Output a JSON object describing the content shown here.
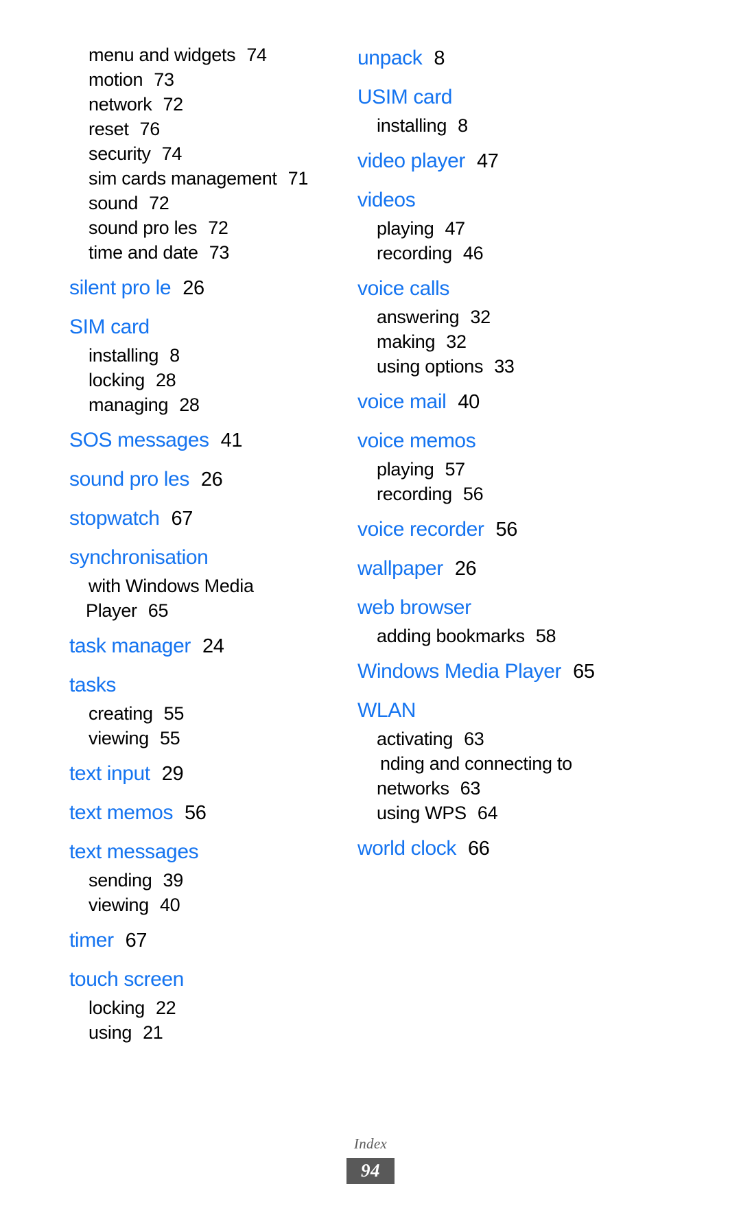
{
  "document": {
    "kind": "index-page",
    "footer_label": "Index",
    "page_number": "94",
    "heading_color": "#1574f0",
    "body_color": "#000000",
    "badge_bg": "#595959",
    "badge_text_color": "#ffffff"
  },
  "columns": [
    {
      "id": "left",
      "entries": [
        {
          "type": "sub",
          "label": "menu and widgets",
          "page": "74"
        },
        {
          "type": "sub",
          "label": "motion",
          "page": "73"
        },
        {
          "type": "sub",
          "label": "network",
          "page": "72"
        },
        {
          "type": "sub",
          "label": "reset",
          "page": "76"
        },
        {
          "type": "sub",
          "label": "security",
          "page": "74"
        },
        {
          "type": "sub",
          "label": "sim cards management",
          "page": "71"
        },
        {
          "type": "sub",
          "label": "sound",
          "page": "72"
        },
        {
          "type": "sub",
          "label": "sound pro  les",
          "page": "72"
        },
        {
          "type": "sub",
          "label": "time and date",
          "page": "73"
        },
        {
          "type": "head",
          "label": "silent pro  le",
          "page": "26"
        },
        {
          "type": "head",
          "label": "SIM card",
          "page": ""
        },
        {
          "type": "sub",
          "label": "installing",
          "page": "8"
        },
        {
          "type": "sub",
          "label": "locking",
          "page": "28"
        },
        {
          "type": "sub",
          "label": "managing",
          "page": "28"
        },
        {
          "type": "head",
          "label": "SOS messages",
          "page": "41"
        },
        {
          "type": "head",
          "label": "sound pro  les",
          "page": "26"
        },
        {
          "type": "head",
          "label": "stopwatch",
          "page": "67"
        },
        {
          "type": "head",
          "label": "synchronisation",
          "page": ""
        },
        {
          "type": "sub",
          "label": "with Windows Media",
          "page": ""
        },
        {
          "type": "sub-cont",
          "label": "Player",
          "page": "65"
        },
        {
          "type": "head",
          "label": "task manager",
          "page": "24"
        },
        {
          "type": "head",
          "label": "tasks",
          "page": ""
        },
        {
          "type": "sub",
          "label": "creating",
          "page": "55"
        },
        {
          "type": "sub",
          "label": "viewing",
          "page": "55"
        },
        {
          "type": "head",
          "label": "text input",
          "page": "29"
        },
        {
          "type": "head",
          "label": "text memos",
          "page": "56"
        },
        {
          "type": "head",
          "label": "text messages",
          "page": ""
        },
        {
          "type": "sub",
          "label": "sending",
          "page": "39"
        },
        {
          "type": "sub",
          "label": "viewing",
          "page": "40"
        },
        {
          "type": "head",
          "label": "timer",
          "page": "67"
        },
        {
          "type": "head",
          "label": "touch screen",
          "page": ""
        },
        {
          "type": "sub",
          "label": "locking",
          "page": "22"
        },
        {
          "type": "sub",
          "label": "using",
          "page": "21"
        }
      ]
    },
    {
      "id": "right",
      "entries": [
        {
          "type": "head",
          "label": "unpack",
          "page": "8"
        },
        {
          "type": "head",
          "label": "USIM card",
          "page": ""
        },
        {
          "type": "sub",
          "label": "installing",
          "page": "8"
        },
        {
          "type": "head",
          "label": "video player",
          "page": "47"
        },
        {
          "type": "head",
          "label": "videos",
          "page": ""
        },
        {
          "type": "sub",
          "label": "playing",
          "page": "47"
        },
        {
          "type": "sub",
          "label": "recording",
          "page": "46"
        },
        {
          "type": "head",
          "label": "voice calls",
          "page": ""
        },
        {
          "type": "sub",
          "label": "answering",
          "page": "32"
        },
        {
          "type": "sub",
          "label": "making",
          "page": "32"
        },
        {
          "type": "sub",
          "label": "using options",
          "page": "33"
        },
        {
          "type": "head",
          "label": "voice mail",
          "page": "40"
        },
        {
          "type": "head",
          "label": "voice memos",
          "page": ""
        },
        {
          "type": "sub",
          "label": "playing",
          "page": "57"
        },
        {
          "type": "sub",
          "label": "recording",
          "page": "56"
        },
        {
          "type": "head",
          "label": "voice recorder",
          "page": "56"
        },
        {
          "type": "head",
          "label": "wallpaper",
          "page": "26"
        },
        {
          "type": "head",
          "label": "web browser",
          "page": ""
        },
        {
          "type": "sub",
          "label": "adding bookmarks",
          "page": "58"
        },
        {
          "type": "head",
          "label": "Windows Media Player",
          "page": "65"
        },
        {
          "type": "head",
          "label": "WLAN",
          "page": ""
        },
        {
          "type": "sub",
          "label": "activating",
          "page": "63"
        },
        {
          "type": "sub-hang",
          "label": " nding and connecting to",
          "page": ""
        },
        {
          "type": "sub",
          "label": "networks",
          "page": "63"
        },
        {
          "type": "sub",
          "label": "using WPS",
          "page": "64"
        },
        {
          "type": "head",
          "label": "world clock",
          "page": "66"
        }
      ]
    }
  ]
}
